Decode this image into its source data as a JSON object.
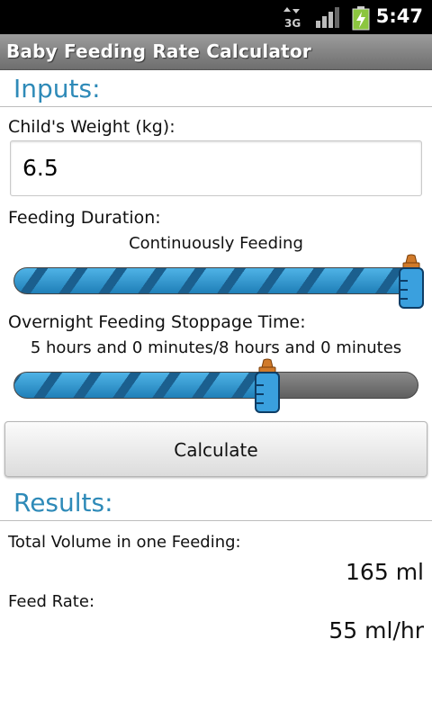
{
  "status_bar": {
    "time": "5:47",
    "network_label": "3G",
    "icons": [
      "network-3g-icon",
      "signal-icon",
      "battery-charging-icon"
    ]
  },
  "app_title": "Baby Feeding Rate Calculator",
  "inputs": {
    "header": "Inputs:",
    "weight_label": "Child's Weight (kg):",
    "weight_value": "6.5",
    "duration_label": "Feeding Duration:",
    "duration_value": "Continuously Feeding",
    "duration_slider_fraction": 1.0,
    "stoppage_label": "Overnight Feeding Stoppage Time:",
    "stoppage_value": "5 hours and 0 minutes/8 hours and 0 minutes",
    "stoppage_slider_fraction": 0.625
  },
  "calculate_label": "Calculate",
  "results": {
    "header": "Results:",
    "total_volume_label": "Total Volume in one Feeding:",
    "total_volume_value": "165 ml",
    "feed_rate_label": "Feed Rate:",
    "feed_rate_value": "55 ml/hr"
  },
  "colors": {
    "accent": "#2e8ab8",
    "slider_fill": "#2b94cf",
    "bottle_cap": "#d07a2a"
  }
}
